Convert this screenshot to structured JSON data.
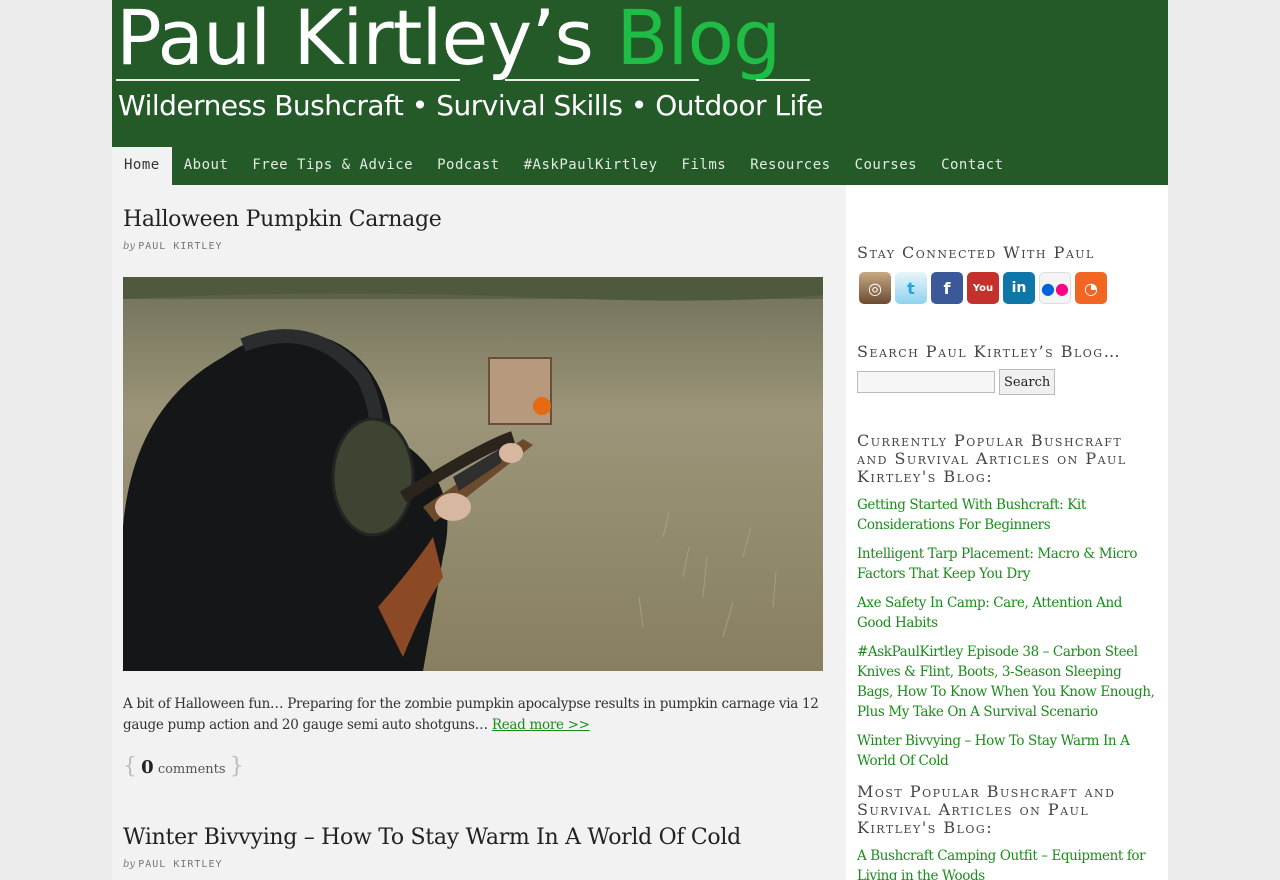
{
  "header": {
    "title_main": "Paul Kirtley’s ",
    "title_accent": "Blog",
    "tagline": "Wilderness Bushcraft • Survival Skills • Outdoor Life"
  },
  "nav": {
    "items": [
      "Home",
      "About",
      "Free Tips & Advice",
      "Podcast",
      "#AskPaulKirtley",
      "Films",
      "Resources",
      "Courses",
      "Contact"
    ],
    "active": "Home"
  },
  "posts": [
    {
      "title": "Halloween Pumpkin Carnage",
      "by": "by",
      "author": "PAUL KIRTLEY",
      "excerpt": "A bit of Halloween fun… Preparing for the zombie pumpkin apocalypse results in pumpkin carnage via 12 gauge pump action and 20 gauge semi auto shotguns…",
      "read_more": "Read more >>",
      "comments_count": "0",
      "comments_label": "comments"
    },
    {
      "title": "Winter Bivvying – How To Stay Warm In A World Of Cold",
      "by": "by",
      "author": "PAUL KIRTLEY"
    }
  ],
  "sidebar": {
    "social_title": "Stay Connected With Paul",
    "social_icons": [
      "instagram-icon",
      "twitter-icon",
      "facebook-icon",
      "youtube-icon",
      "linkedin-icon",
      "flickr-icon",
      "rss-icon"
    ],
    "search_title": "Search Paul Kirtley’s Blog…",
    "search_value": "",
    "search_button": "Search",
    "current_title": "Currently Popular Bushcraft and Survival Articles on Paul Kirtley's Blog:",
    "current_links": [
      "Getting Started With Bushcraft: Kit Considerations For Beginners",
      "Intelligent Tarp Placement: Macro & Micro Factors That Keep You Dry",
      "Axe Safety In Camp: Care, Attention And Good Habits",
      "#AskPaulKirtley Episode 38 – Carbon Steel Knives & Flint, Boots, 3-Season Sleeping Bags, How To Know When You Know Enough, Plus My Take On A Survival Scenario",
      "Winter Bivvying – How To Stay Warm In A World Of Cold"
    ],
    "most_title": "Most Popular Bushcraft and Survival Articles on Paul Kirtley's Blog:",
    "most_links": [
      "A Bushcraft Camping Outfit – Equipment for Living in the Woods"
    ]
  },
  "colors": {
    "header_green": "#245a27",
    "accent_green": "#1fbc46",
    "link_green": "#1a8c1a"
  }
}
